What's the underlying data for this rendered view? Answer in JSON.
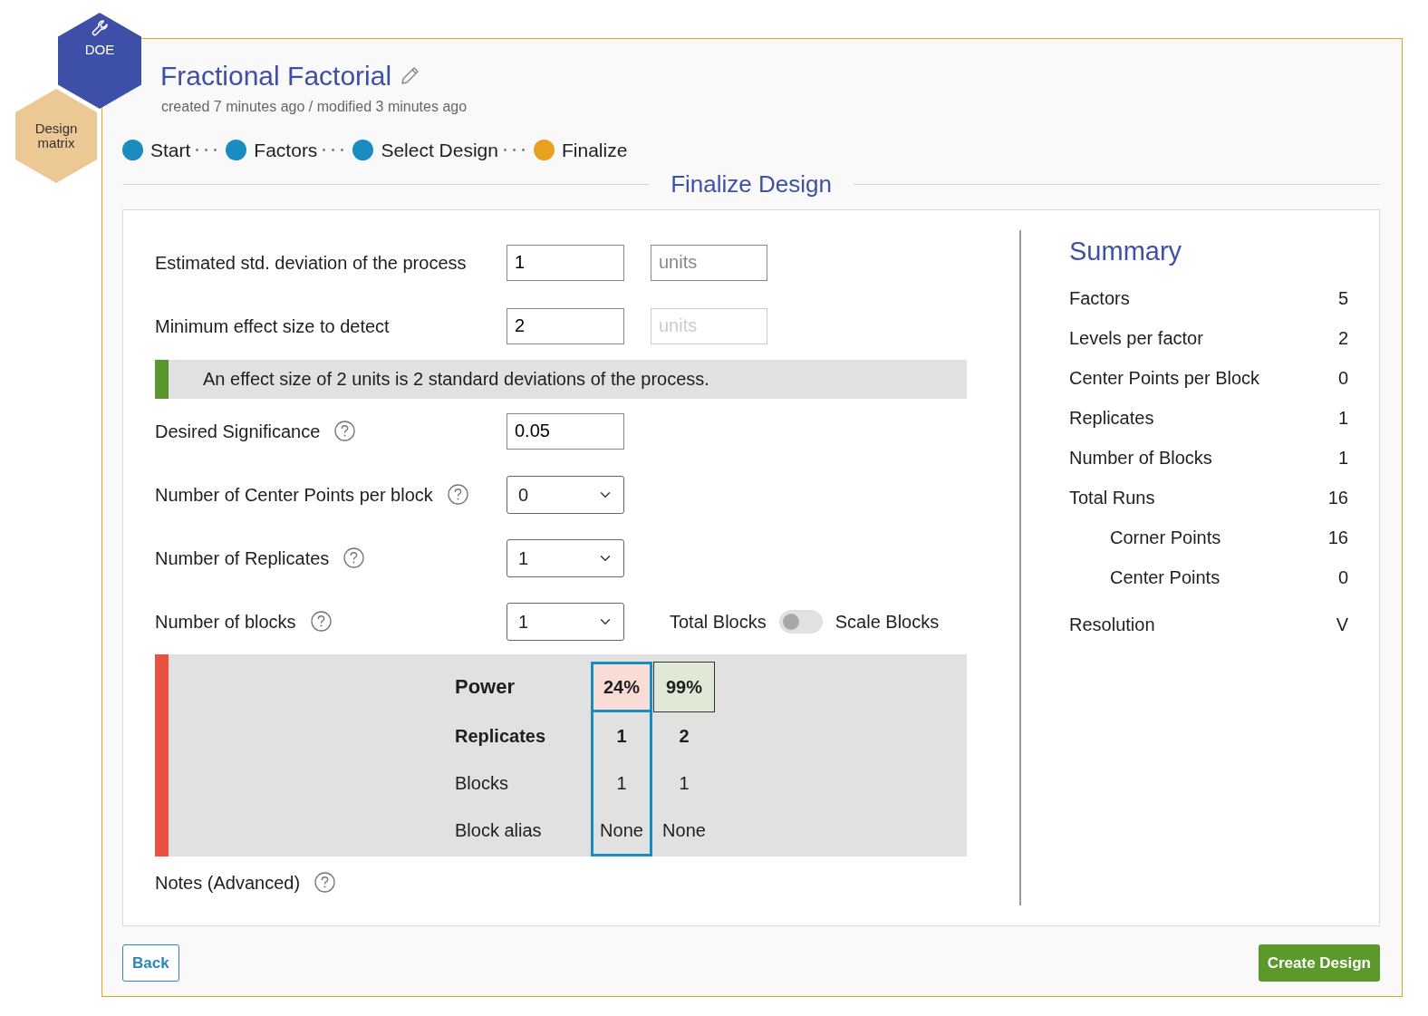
{
  "side_tabs": [
    {
      "label": "DOE",
      "selected": true
    },
    {
      "label": "Design matrix",
      "selected": false
    }
  ],
  "title": "Fractional Factorial",
  "subtitle": "created 7 minutes ago / modified 3 minutes ago",
  "steps": [
    {
      "label": "Start",
      "current": false
    },
    {
      "label": "Factors",
      "current": false
    },
    {
      "label": "Select Design",
      "current": false
    },
    {
      "label": "Finalize",
      "current": true
    }
  ],
  "section_title": "Finalize Design",
  "form": {
    "rows": [
      {
        "kind": "input",
        "label": "Estimated std. deviation of the process",
        "help": false,
        "value": "1",
        "unit": {
          "placeholder": "units",
          "disabled": false
        }
      },
      {
        "kind": "input",
        "label": "Minimum effect size to detect",
        "help": false,
        "value": "2",
        "unit": {
          "placeholder": "units",
          "disabled": true
        }
      },
      {
        "kind": "note",
        "text": "An effect size of 2 units is 2 standard deviations of the process.",
        "color": "#5a962e"
      },
      {
        "kind": "input",
        "label": "Desired Significance",
        "help": true,
        "value": "0.05"
      },
      {
        "kind": "select",
        "label": "Number of Center Points per block",
        "help": true,
        "value": "0"
      },
      {
        "kind": "select",
        "label": "Number of Replicates",
        "help": true,
        "value": "1"
      },
      {
        "kind": "select",
        "label": "Number of blocks",
        "help": true,
        "value": "1",
        "switch": {
          "left_label": "Total Blocks",
          "right_label": "Scale Blocks",
          "on": false
        }
      },
      {
        "kind": "power_table",
        "color": "#e8513f",
        "row_labels": [
          {
            "label": "Power",
            "bold": true
          },
          {
            "label": "Replicates",
            "bold": true
          },
          {
            "label": "Blocks",
            "bold": false
          },
          {
            "label": "Block alias",
            "bold": false
          }
        ],
        "options": [
          {
            "selected": true,
            "color": "#fadcd7",
            "power": "24%",
            "replicates": "1",
            "blocks": "1",
            "block_alias": "None"
          },
          {
            "selected": false,
            "color": "#dfe9d5",
            "power": "99%",
            "replicates": "2",
            "blocks": "1",
            "block_alias": "None"
          }
        ]
      },
      {
        "kind": "label",
        "label": "Notes (Advanced)",
        "help": true
      }
    ]
  },
  "summary": {
    "title": "Summary",
    "items": [
      {
        "label": "Factors",
        "value": "5"
      },
      {
        "label": "Levels per factor",
        "value": "2"
      },
      {
        "label": "Center Points per Block",
        "value": "0"
      },
      {
        "label": "Replicates",
        "value": "1"
      },
      {
        "label": "Number of Blocks",
        "value": "1"
      },
      {
        "label": "Total Runs",
        "value": "16",
        "children": [
          {
            "label": "Corner Points",
            "value": "16"
          },
          {
            "label": "Center Points",
            "value": "0"
          }
        ]
      },
      {
        "label": "Resolution",
        "value": "V"
      }
    ]
  },
  "buttons": [
    {
      "label": "Back",
      "kind": "secondary"
    },
    {
      "label": "Create Design",
      "kind": "primary"
    }
  ]
}
